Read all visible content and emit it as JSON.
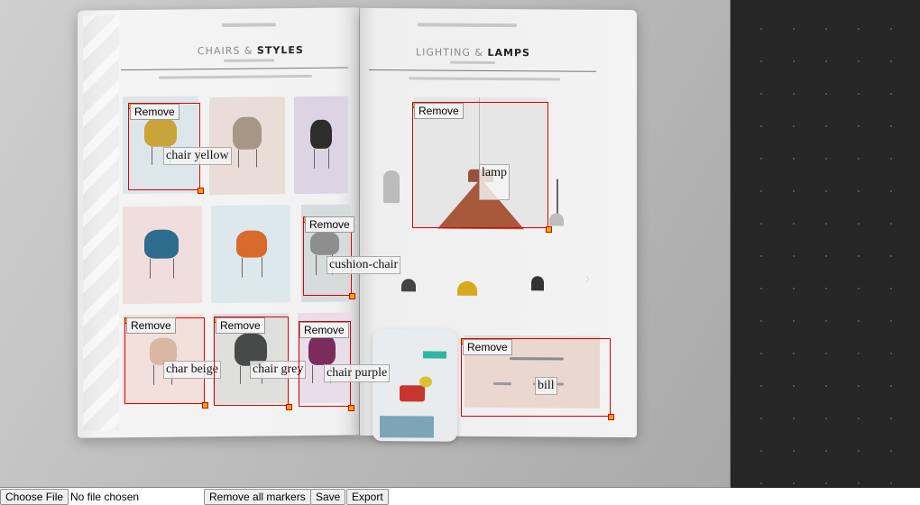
{
  "magazine": {
    "left_title_light": "CHAIRS &",
    "left_title_bold": "STYLES",
    "right_title_light": "LIGHTING &",
    "right_title_bold": "LAMPS"
  },
  "markers": [
    {
      "label": "chair yellow",
      "remove_label": "Remove"
    },
    {
      "label": "lamp",
      "remove_label": "Remove"
    },
    {
      "label": "cushion-chair",
      "remove_label": "Remove"
    },
    {
      "label": "char beige",
      "remove_label": "Remove"
    },
    {
      "label": "chair grey",
      "remove_label": "Remove"
    },
    {
      "label": "chair purple",
      "remove_label": "Remove"
    },
    {
      "label": "bill",
      "remove_label": "Remove"
    }
  ],
  "toolbar": {
    "choose_file_label": "Choose File",
    "file_status": "No file chosen",
    "remove_all_label": "Remove all markers",
    "save_label": "Save",
    "export_label": "Export"
  },
  "colors": {
    "marker_border": "#e00000",
    "handle_fill": "#ffa500",
    "side_panel": "#262626"
  }
}
